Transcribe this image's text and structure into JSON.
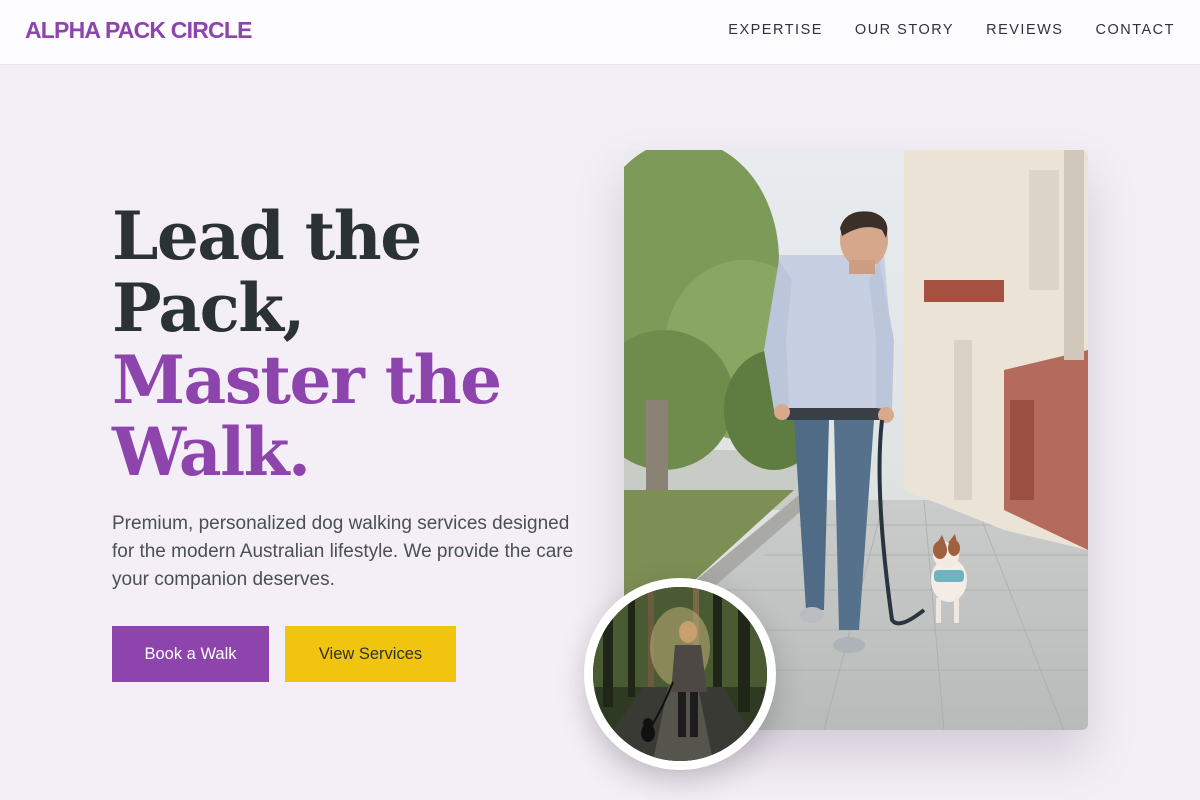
{
  "header": {
    "logo": "ALPHA PACK CIRCLE",
    "nav": [
      "EXPERTISE",
      "OUR STORY",
      "REVIEWS",
      "CONTACT"
    ]
  },
  "hero": {
    "headline_line1": "Lead the",
    "headline_line2": "Pack,",
    "headline_line3": "Master the",
    "headline_line4": "Walk.",
    "subtext": "Premium, personalized dog walking services designed for the modern Australian lifestyle. We provide the care your companion deserves.",
    "primary_button": "Book a Walk",
    "secondary_button": "View Services"
  },
  "colors": {
    "accent": "#8e44ad",
    "secondary": "#f1c40f",
    "text_dark": "#2b3235",
    "background": "#f4eff6"
  },
  "images": {
    "main": "man-walking-small-dog-on-city-sidewalk",
    "inset": "woman-walking-dog-on-forest-path"
  }
}
